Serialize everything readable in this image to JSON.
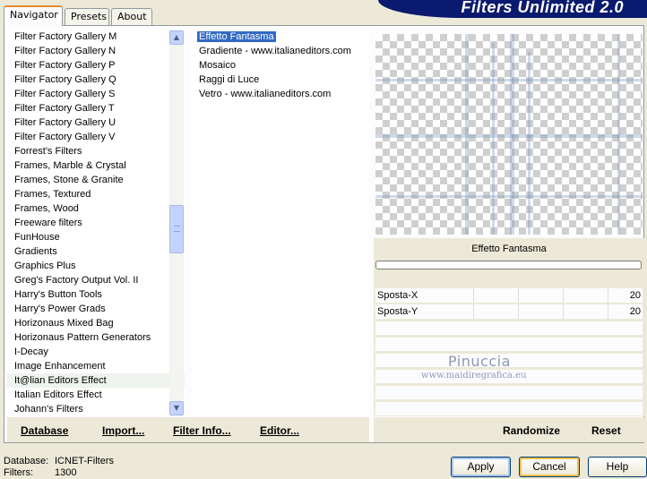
{
  "tabs": {
    "navigator": "Navigator",
    "presets": "Presets",
    "about": "About"
  },
  "banner": {
    "title": "Filters Unlimited 2.0"
  },
  "categories": [
    "Filter Factory Gallery M",
    "Filter Factory Gallery N",
    "Filter Factory Gallery P",
    "Filter Factory Gallery Q",
    "Filter Factory Gallery S",
    "Filter Factory Gallery T",
    "Filter Factory Gallery U",
    "Filter Factory Gallery V",
    "Forrest's Filters",
    "Frames, Marble & Crystal",
    "Frames, Stone & Granite",
    "Frames, Textured",
    "Frames, Wood",
    "Freeware filters",
    "FunHouse",
    "Gradients",
    "Graphics Plus",
    "Greg's Factory Output Vol. II",
    "Harry's Button Tools",
    "Harry's Power Grads",
    "Horizonaus Mixed Bag",
    "Horizonaus Pattern Generators",
    "I-Decay",
    "Image Enhancement",
    "It@lian Editors Effect",
    "Italian Editors Effect",
    "Johann's Filters"
  ],
  "selected_category_index": 24,
  "filters": [
    "Effetto Fantasma",
    "Gradiente - www.italianeditors.com",
    "Mosaico",
    "Raggi di Luce",
    "Vetro - www.italianeditors.com"
  ],
  "selected_filter_index": 0,
  "effect": {
    "name": "Effetto Fantasma",
    "params": [
      {
        "label": "Sposta-X",
        "value": "20"
      },
      {
        "label": "Sposta-Y",
        "value": "20"
      }
    ]
  },
  "watermark": {
    "name": "Pinuccia",
    "url": "www.maidiregrafica.eu"
  },
  "actions": {
    "database": "Database",
    "import": "Import...",
    "filter_info": "Filter Info...",
    "editor": "Editor...",
    "randomize": "Randomize",
    "reset": "Reset"
  },
  "status": {
    "database_label": "Database:",
    "database_value": "ICNET-Filters",
    "filters_label": "Filters:",
    "filters_value": "1300"
  },
  "buttons": {
    "apply": "Apply",
    "cancel": "Cancel",
    "help": "Help"
  },
  "colors": {
    "banner": "#0a1a6e",
    "selection": "#316ac5",
    "dialog_bg": "#ece9d8"
  }
}
